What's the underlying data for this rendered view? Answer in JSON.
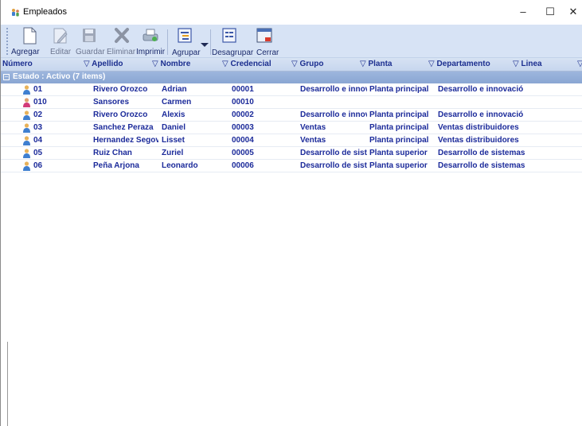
{
  "window": {
    "title": "Empleados",
    "minimize": "–",
    "maximize": "☐",
    "close": "✕"
  },
  "toolbar": {
    "agregar": "Agregar",
    "editar": "Editar",
    "guardar": "Guardar",
    "eliminar": "Eliminar",
    "imprimir": "Imprimir",
    "agrupar": "Agrupar",
    "desagrupar": "Desagrupar",
    "cerrar": "Cerrar"
  },
  "columns": {
    "numero": "Número",
    "apellido": "▽ Apellido",
    "nombre": "▽ Nombre",
    "credencial": "▽ Credencial",
    "grupo": "▽ Grupo",
    "planta": "▽ Planta",
    "departamento": "▽ Departamento",
    "linea": "▽ Linea",
    "more": "▽"
  },
  "group": {
    "toggle": "−",
    "label": "Estado : Activo (7 items)"
  },
  "rows": [
    {
      "numero": "01",
      "apellido": "Rivero Orozco",
      "nombre": "Adrian",
      "credencial": "00001",
      "grupo": "Desarrollo e innov",
      "planta": "Planta principal",
      "departamento": "Desarrollo e innovació",
      "gender": "male"
    },
    {
      "numero": "010",
      "apellido": "Sansores",
      "nombre": "Carmen",
      "credencial": "00010",
      "grupo": "",
      "planta": "",
      "departamento": "",
      "gender": "female"
    },
    {
      "numero": "02",
      "apellido": "Rivero Orozco",
      "nombre": "Alexis",
      "credencial": "00002",
      "grupo": "Desarrollo e innov",
      "planta": "Planta principal",
      "departamento": "Desarrollo e innovació",
      "gender": "male"
    },
    {
      "numero": "03",
      "apellido": "Sanchez Peraza",
      "nombre": "Daniel",
      "credencial": "00003",
      "grupo": "Ventas",
      "planta": "Planta principal",
      "departamento": "Ventas distribuidores",
      "gender": "male"
    },
    {
      "numero": "04",
      "apellido": "Hernandez Segovi",
      "nombre": "Lisset",
      "credencial": "00004",
      "grupo": "Ventas",
      "planta": "Planta principal",
      "departamento": "Ventas distribuidores",
      "gender": "male"
    },
    {
      "numero": "05",
      "apellido": "Ruiz Chan",
      "nombre": "Zuriel",
      "credencial": "00005",
      "grupo": "Desarrollo de sist",
      "planta": "Planta superior",
      "departamento": "Desarrollo de sistemas",
      "gender": "male"
    },
    {
      "numero": "06",
      "apellido": "Peña Arjona",
      "nombre": "Leonardo",
      "credencial": "00006",
      "grupo": "Desarrollo de sist",
      "planta": "Planta superior",
      "departamento": "Desarrollo de sistemas",
      "gender": "male"
    }
  ],
  "colors": {
    "toolbar_bg": "#d7e3f5",
    "group_bg": "#8aa6d3",
    "text": "#1b2a9a"
  }
}
